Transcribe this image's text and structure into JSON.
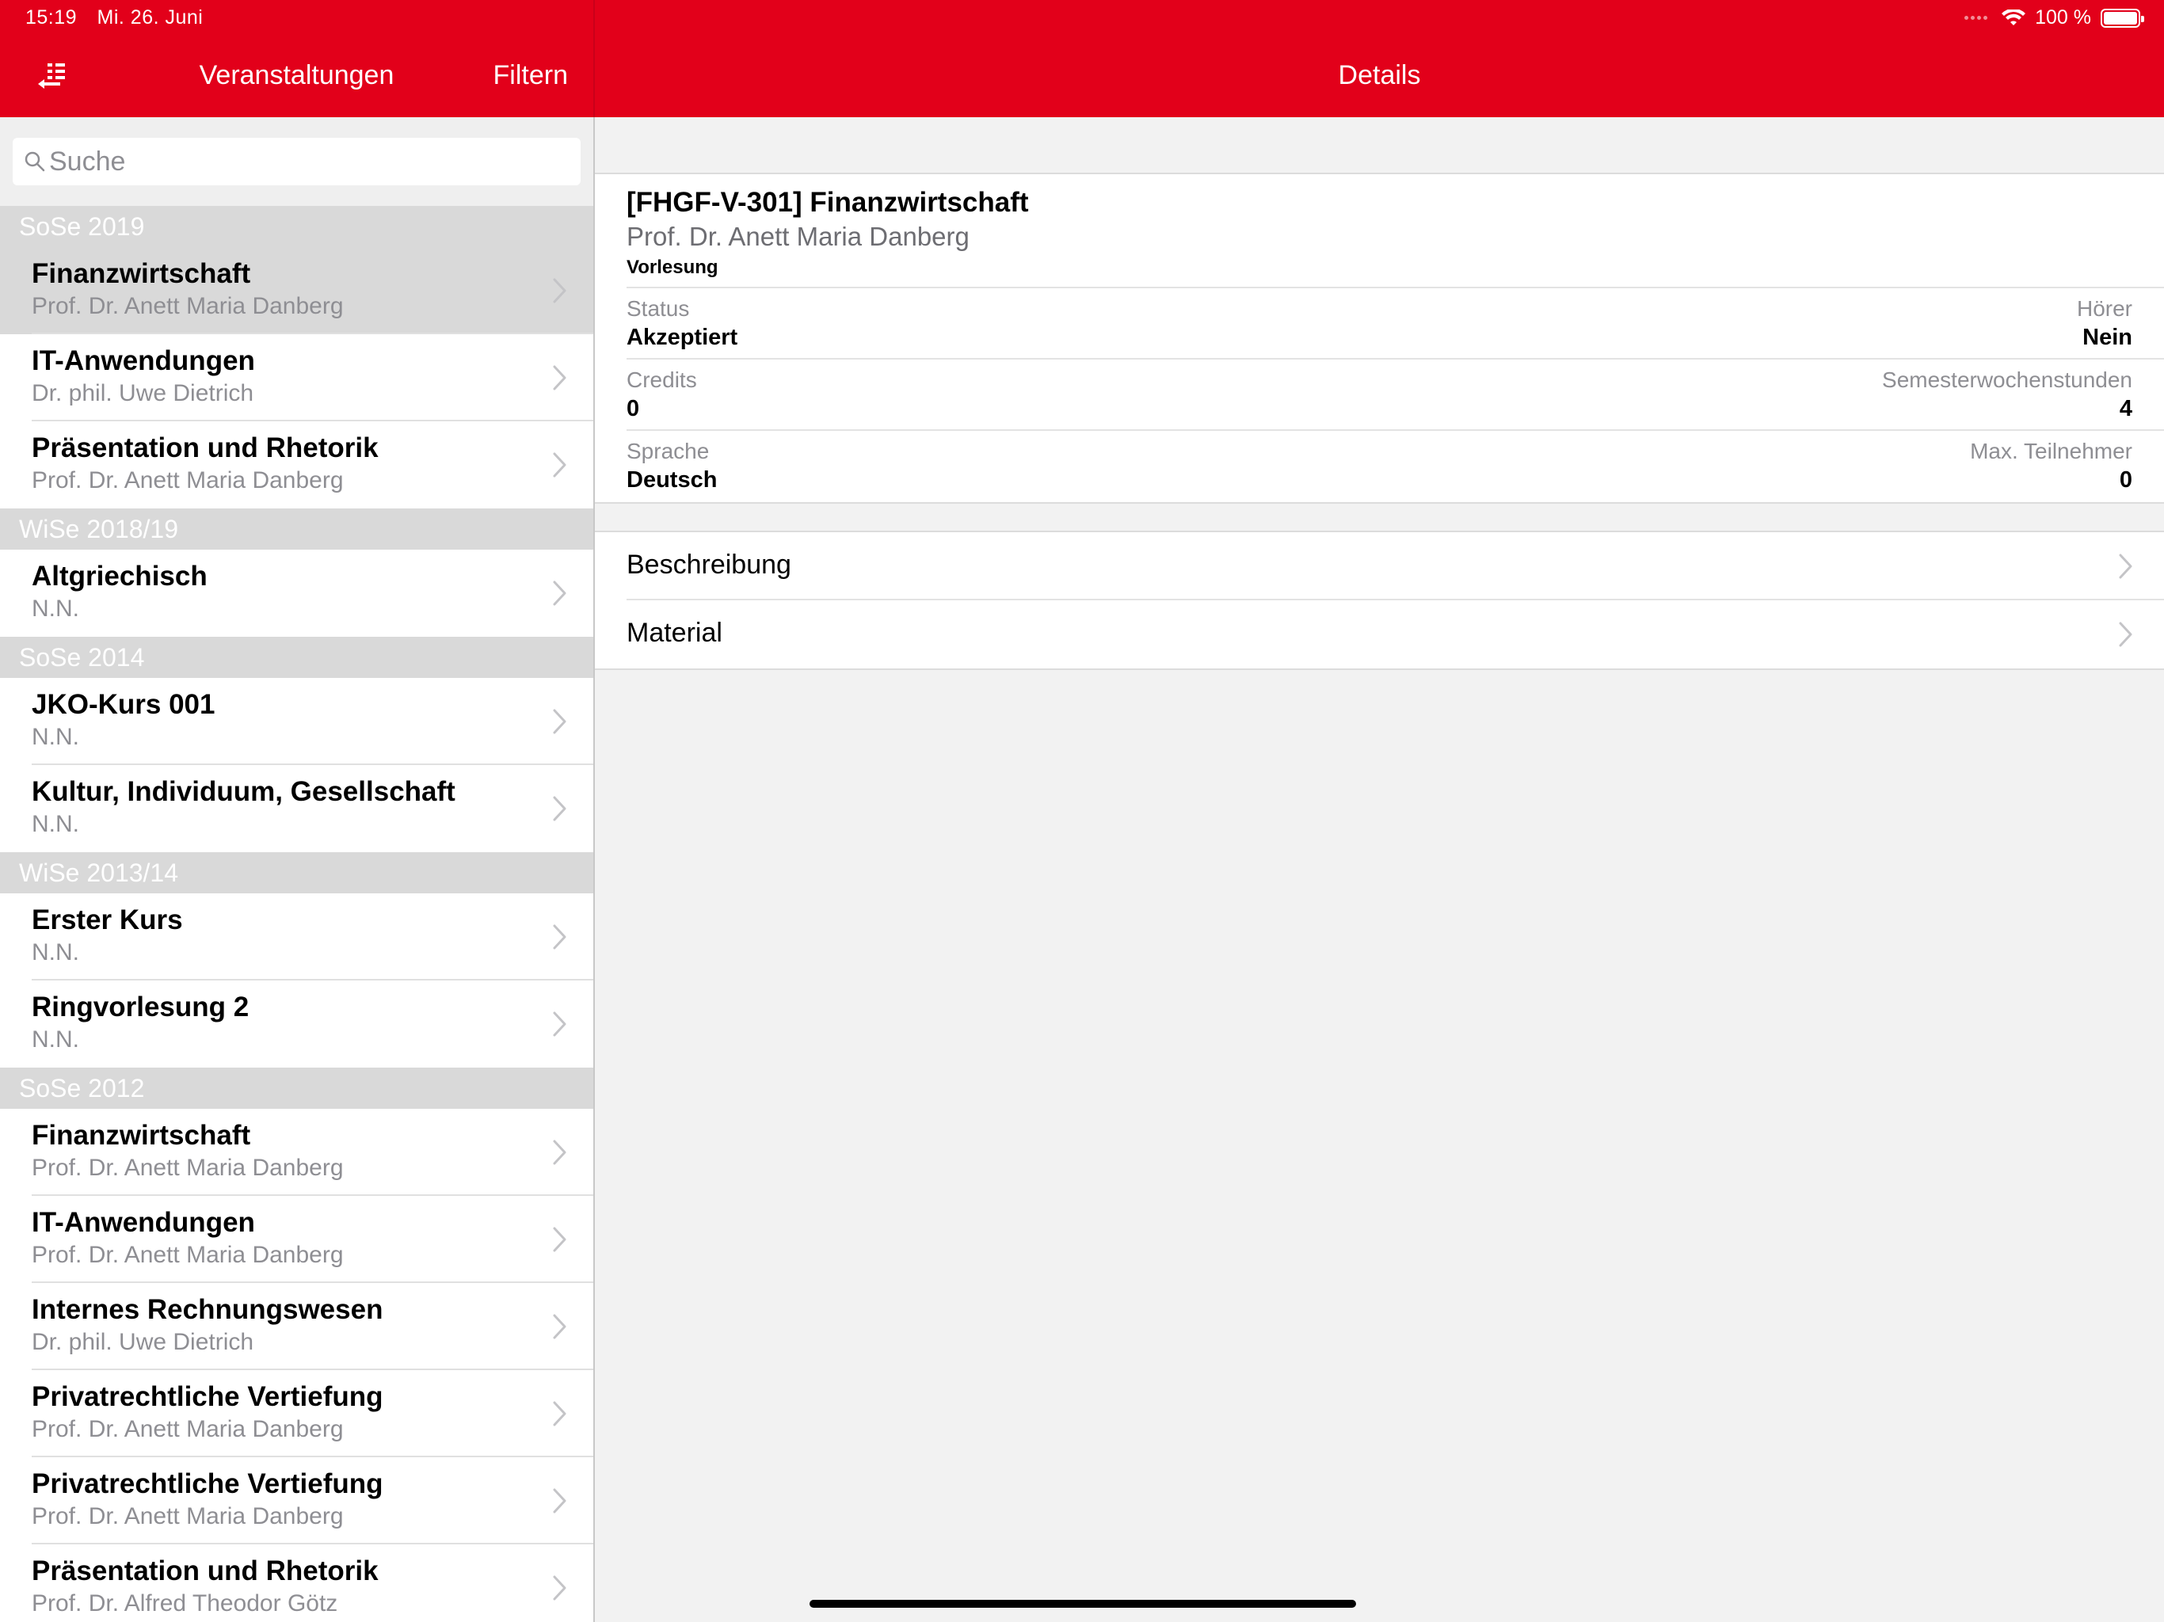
{
  "status_bar": {
    "time": "15:19",
    "date": "Mi. 26. Juni",
    "battery": "100 %"
  },
  "colors": {
    "accent": "#e2001a",
    "section_bg": "#d9d9d9"
  },
  "left_nav": {
    "menu_icon": "list-back-icon",
    "title": "Veranstaltungen",
    "filter_label": "Filtern"
  },
  "search": {
    "placeholder": "Suche",
    "value": ""
  },
  "sections": [
    {
      "header": "SoSe 2019",
      "items": [
        {
          "title": "Finanzwirtschaft",
          "subtitle": "Prof. Dr. Anett Maria Danberg",
          "selected": true
        },
        {
          "title": "IT-Anwendungen",
          "subtitle": "Dr. phil. Uwe Dietrich"
        },
        {
          "title": "Präsentation und Rhetorik",
          "subtitle": "Prof. Dr. Anett Maria Danberg"
        }
      ]
    },
    {
      "header": "WiSe 2018/19",
      "items": [
        {
          "title": "Altgriechisch",
          "subtitle": "N.N."
        }
      ]
    },
    {
      "header": "SoSe 2014",
      "items": [
        {
          "title": "JKO-Kurs 001",
          "subtitle": "N.N."
        },
        {
          "title": "Kultur, Individuum, Gesellschaft",
          "subtitle": "N.N."
        }
      ]
    },
    {
      "header": "WiSe 2013/14",
      "items": [
        {
          "title": "Erster Kurs",
          "subtitle": "N.N."
        },
        {
          "title": "Ringvorlesung 2",
          "subtitle": "N.N."
        }
      ]
    },
    {
      "header": "SoSe 2012",
      "items": [
        {
          "title": "Finanzwirtschaft",
          "subtitle": "Prof. Dr. Anett Maria Danberg"
        },
        {
          "title": "IT-Anwendungen",
          "subtitle": "Prof. Dr. Anett Maria Danberg"
        },
        {
          "title": "Internes Rechnungswesen",
          "subtitle": "Dr. phil. Uwe Dietrich"
        },
        {
          "title": "Privatrechtliche Vertiefung",
          "subtitle": "Prof. Dr. Anett Maria Danberg"
        },
        {
          "title": "Privatrechtliche Vertiefung",
          "subtitle": "Prof. Dr. Anett Maria Danberg"
        },
        {
          "title": "Präsentation und Rhetorik",
          "subtitle": "Prof. Dr. Alfred Theodor Götz"
        }
      ]
    }
  ],
  "detail": {
    "nav_title": "Details",
    "course_title": "[FHGF-V-301] Finanzwirtschaft",
    "lecturer": "Prof. Dr. Anett Maria Danberg",
    "type": "Vorlesung",
    "fields": [
      {
        "left_label": "Status",
        "left_value": "Akzeptiert",
        "right_label": "Hörer",
        "right_value": "Nein"
      },
      {
        "left_label": "Credits",
        "left_value": "0",
        "right_label": "Semesterwochenstunden",
        "right_value": "4"
      },
      {
        "left_label": "Sprache",
        "left_value": "Deutsch",
        "right_label": "Max. Teilnehmer",
        "right_value": "0"
      }
    ],
    "links": [
      {
        "label": "Beschreibung"
      },
      {
        "label": "Material"
      }
    ]
  }
}
